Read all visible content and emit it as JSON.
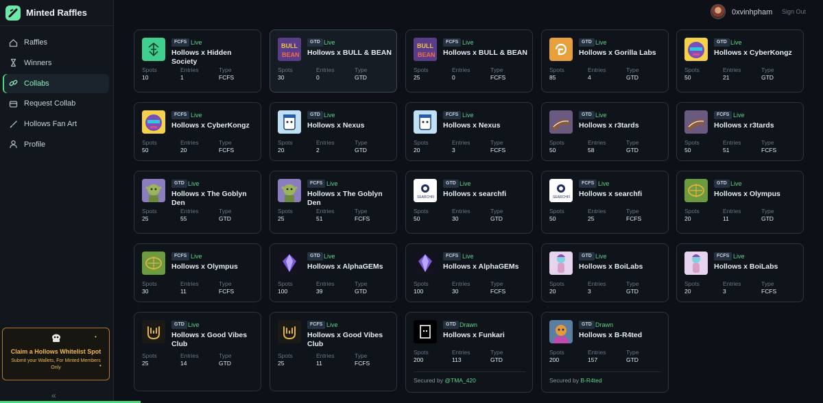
{
  "app": {
    "title": "Minted Raffles"
  },
  "sidebar": {
    "items": [
      {
        "label": "Raffles",
        "icon": "home-icon"
      },
      {
        "label": "Winners",
        "icon": "hourglass-icon"
      },
      {
        "label": "Collabs",
        "icon": "link-icon",
        "active": true
      },
      {
        "label": "Request Collab",
        "icon": "folder-icon"
      },
      {
        "label": "Hollows Fan Art",
        "icon": "brush-icon"
      },
      {
        "label": "Profile",
        "icon": "user-icon"
      }
    ],
    "promo": {
      "title": "Claim a Hollows Whitelist Spot",
      "subtitle": "Submit your Wallets, For Minted Members Only"
    },
    "collapse_icon": "«"
  },
  "header": {
    "username": "0xvinhpham",
    "signout": "Sign Out"
  },
  "labels": {
    "spots": "Spots",
    "entries": "Entries",
    "type": "Type",
    "secured_by": "Secured by"
  },
  "cards": [
    {
      "type": "FCFS",
      "status": "Live",
      "title": "Hollows x Hidden Society",
      "spots": "10",
      "entries": "1",
      "thumb": "hidden"
    },
    {
      "type": "GTD",
      "status": "Live",
      "title": "Hollows x BULL & BEAN",
      "spots": "30",
      "entries": "0",
      "thumb": "bull"
    },
    {
      "type": "FCFS",
      "status": "Live",
      "title": "Hollows x BULL & BEAN",
      "spots": "25",
      "entries": "0",
      "thumb": "bull"
    },
    {
      "type": "GTD",
      "status": "Live",
      "title": "Hollows x Gorilla Labs",
      "spots": "85",
      "entries": "4",
      "thumb": "gorilla"
    },
    {
      "type": "GTD",
      "status": "Live",
      "title": "Hollows x CyberKongz",
      "spots": "50",
      "entries": "21",
      "thumb": "kongz"
    },
    {
      "type": "FCFS",
      "status": "Live",
      "title": "Hollows x CyberKongz",
      "spots": "50",
      "entries": "20",
      "thumb": "kongz"
    },
    {
      "type": "GTD",
      "status": "Live",
      "title": "Hollows x Nexus",
      "spots": "20",
      "entries": "2",
      "thumb": "nexus"
    },
    {
      "type": "FCFS",
      "status": "Live",
      "title": "Hollows x Nexus",
      "spots": "20",
      "entries": "3",
      "thumb": "nexus"
    },
    {
      "type": "GTD",
      "status": "Live",
      "title": "Hollows x r3tards",
      "spots": "50",
      "entries": "58",
      "thumb": "r3"
    },
    {
      "type": "FCFS",
      "status": "Live",
      "title": "Hollows x r3tards",
      "spots": "50",
      "entries": "51",
      "thumb": "r3"
    },
    {
      "type": "GTD",
      "status": "Live",
      "title": "Hollows x The Goblyn Den",
      "spots": "25",
      "entries": "55",
      "thumb": "goblyn"
    },
    {
      "type": "FCFS",
      "status": "Live",
      "title": "Hollows x The Goblyn Den",
      "spots": "25",
      "entries": "51",
      "thumb": "goblyn"
    },
    {
      "type": "GTD",
      "status": "Live",
      "title": "Hollows x searchfi",
      "spots": "50",
      "entries": "30",
      "thumb": "searchfi"
    },
    {
      "type": "FCFS",
      "status": "Live",
      "title": "Hollows x searchfi",
      "spots": "50",
      "entries": "25",
      "thumb": "searchfi"
    },
    {
      "type": "GTD",
      "status": "Live",
      "title": "Hollows x Olympus",
      "spots": "20",
      "entries": "11",
      "thumb": "olympus"
    },
    {
      "type": "FCFS",
      "status": "Live",
      "title": "Hollows x Olympus",
      "spots": "30",
      "entries": "11",
      "thumb": "olympus"
    },
    {
      "type": "GTD",
      "status": "Live",
      "title": "Hollows x AlphaGEMs",
      "spots": "100",
      "entries": "39",
      "thumb": "gems"
    },
    {
      "type": "FCFS",
      "status": "Live",
      "title": "Hollows x AlphaGEMs",
      "spots": "100",
      "entries": "30",
      "thumb": "gems"
    },
    {
      "type": "GTD",
      "status": "Live",
      "title": "Hollows x BoiLabs",
      "spots": "20",
      "entries": "3",
      "thumb": "boi"
    },
    {
      "type": "FCFS",
      "status": "Live",
      "title": "Hollows x BoiLabs",
      "spots": "20",
      "entries": "3",
      "thumb": "boi"
    },
    {
      "type": "GTD",
      "status": "Live",
      "title": "Hollows x Good Vibes Club",
      "spots": "25",
      "entries": "14",
      "thumb": "vibes"
    },
    {
      "type": "FCFS",
      "status": "Live",
      "title": "Hollows x Good Vibes Club",
      "spots": "25",
      "entries": "11",
      "thumb": "vibes"
    },
    {
      "type": "GTD",
      "status": "Drawn",
      "title": "Hollows x Funkari",
      "spots": "200",
      "entries": "113",
      "thumb": "funkari",
      "secured_by": "@TMA_420"
    },
    {
      "type": "GTD",
      "status": "Drawn",
      "title": "Hollows x B-R4ted",
      "spots": "200",
      "entries": "157",
      "thumb": "br4",
      "secured_by": "B-R4ted"
    }
  ]
}
